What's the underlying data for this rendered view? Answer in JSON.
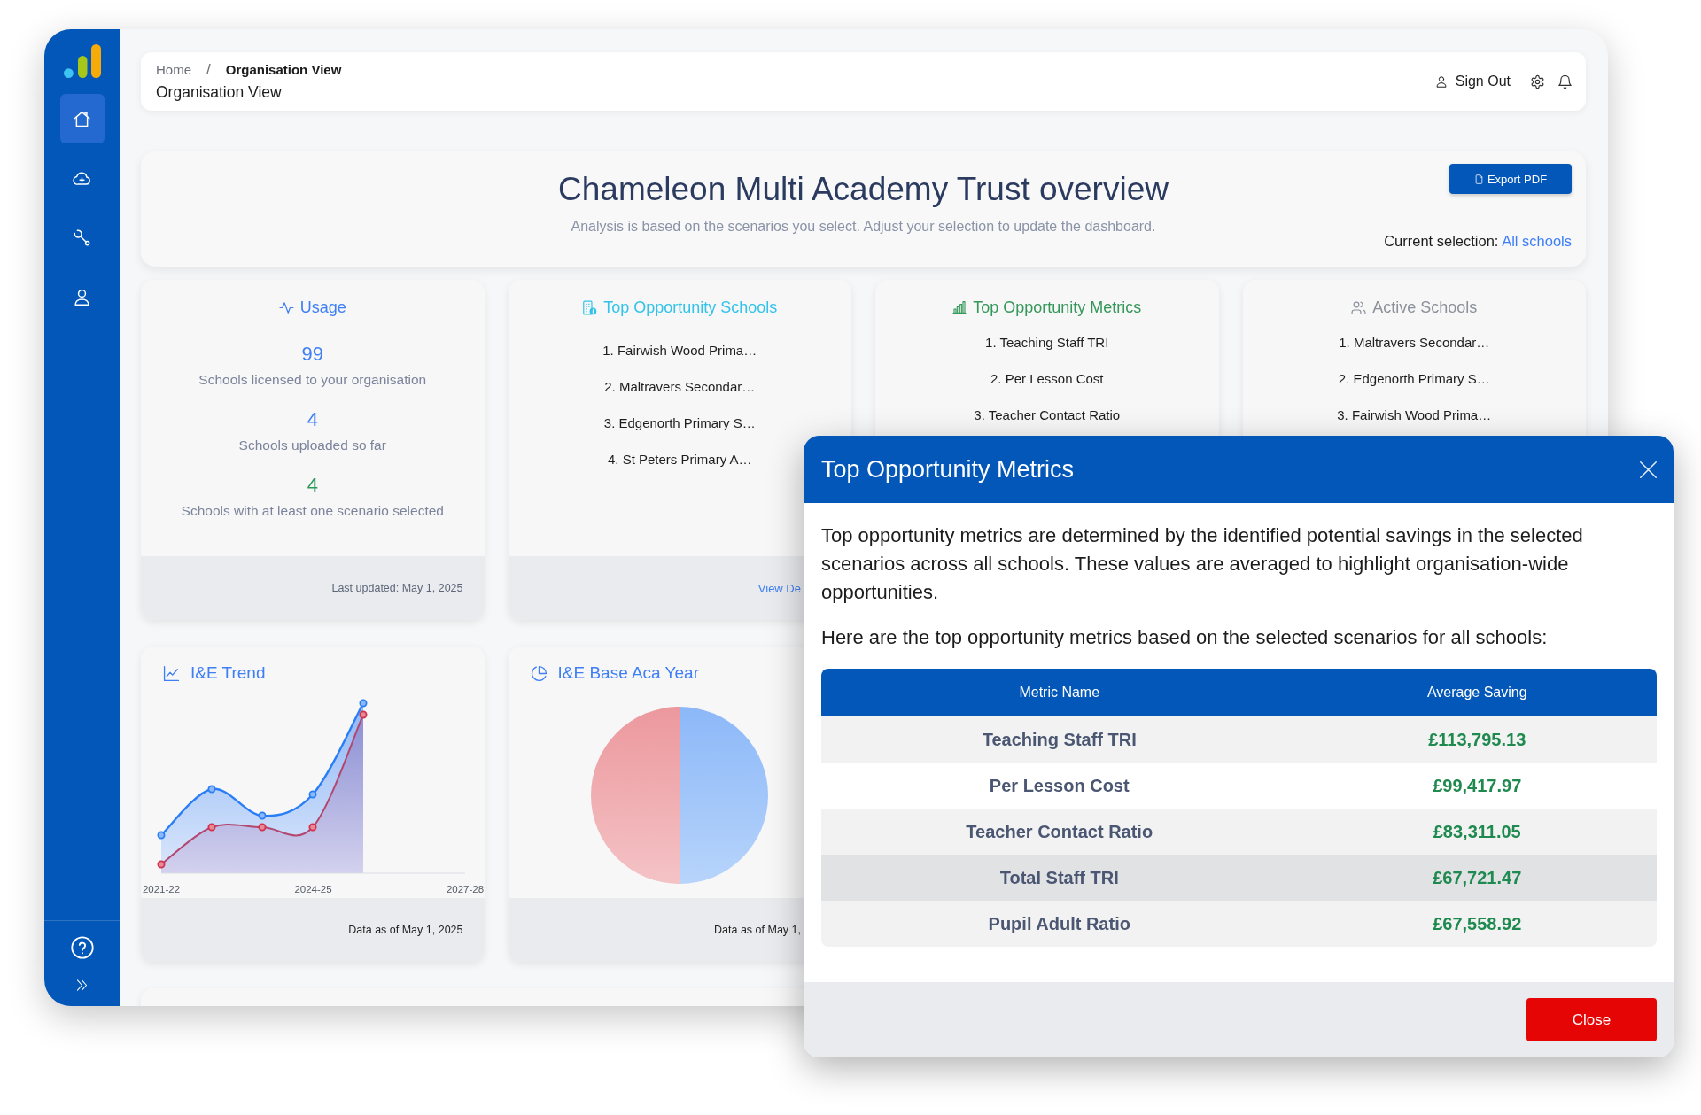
{
  "sidebar": {
    "items": [
      {
        "kind": "home",
        "selected": true
      },
      {
        "kind": "upload",
        "selected": false
      },
      {
        "kind": "tools",
        "selected": false
      },
      {
        "kind": "profile",
        "selected": false
      }
    ]
  },
  "header": {
    "breadcrumb": [
      {
        "label": "Home",
        "current": false
      },
      {
        "label": "Organisation View",
        "current": true
      }
    ],
    "separator": "/",
    "page_title": "Organisation View",
    "sign_out": "Sign Out"
  },
  "overview": {
    "title": "Chameleon Multi Academy Trust overview",
    "subtitle": "Analysis is based on the scenarios you select. Adjust your selection to update the dashboard.",
    "export_button": "Export PDF",
    "selection_label": "Current selection:",
    "selection_value": "All schools"
  },
  "summary_cards": [
    {
      "kind": "usage",
      "title": "Usage",
      "color": "#3f7ff5",
      "stats": [
        {
          "value": "99",
          "label": "Schools licensed to your organisation",
          "color": "#3f7ff5"
        },
        {
          "value": "4",
          "label": "Schools uploaded so far",
          "color": "#3f7ff5"
        },
        {
          "value": "4",
          "label": "Schools with at least one scenario selected",
          "color": "#2e9a5a"
        }
      ],
      "footer": "Last updated: May 1, 2025"
    },
    {
      "kind": "schools",
      "title": "Top Opportunity Schools",
      "color": "#33c3ea",
      "items": [
        "1. Fairwish Wood Prima…",
        "2. Maltravers Secondar…",
        "3. Edgenorth Primary S…",
        "4. St Peters Primary A…"
      ],
      "link": "View De"
    },
    {
      "kind": "metrics",
      "title": "Top Opportunity Metrics",
      "color": "#35985a",
      "items": [
        "1. Teaching Staff TRI",
        "2. Per Lesson Cost",
        "3. Teacher Contact Ratio"
      ]
    },
    {
      "kind": "active",
      "title": "Active Schools",
      "color": "#8b9099",
      "items": [
        "1. Maltravers Secondar…",
        "2. Edgenorth Primary S…",
        "3. Fairwish Wood Prima…"
      ]
    }
  ],
  "chart_cards": [
    {
      "kind": "trend",
      "title": "I&E Trend",
      "x_labels": [
        "2021-22",
        "2024-25",
        "2027-28"
      ],
      "footer": "Data as of May 1, 2025"
    },
    {
      "kind": "pie",
      "title": "I&E Base Aca Year",
      "footer": "Data as of May 1,"
    }
  ],
  "modal": {
    "title": "Top Opportunity Metrics",
    "paragraphs": [
      "Top opportunity metrics are determined by the identified potential savings in the selected scenarios across all schools. These values are averaged to highlight organisation-wide opportunities.",
      "Here are the top opportunity metrics based on the selected scenarios for all schools:"
    ],
    "table": {
      "columns": [
        "Metric Name",
        "Average Saving"
      ],
      "rows": [
        {
          "metric": "Teaching Staff TRI",
          "saving": "£113,795.13",
          "hovered": false
        },
        {
          "metric": "Per Lesson Cost",
          "saving": "£99,417.97",
          "hovered": false
        },
        {
          "metric": "Teacher Contact Ratio",
          "saving": "£83,311.05",
          "hovered": false
        },
        {
          "metric": "Total Staff TRI",
          "saving": "£67,721.47",
          "hovered": true
        },
        {
          "metric": "Pupil Adult Ratio",
          "saving": "£67,558.92",
          "hovered": false
        }
      ]
    },
    "close_button": "Close"
  }
}
